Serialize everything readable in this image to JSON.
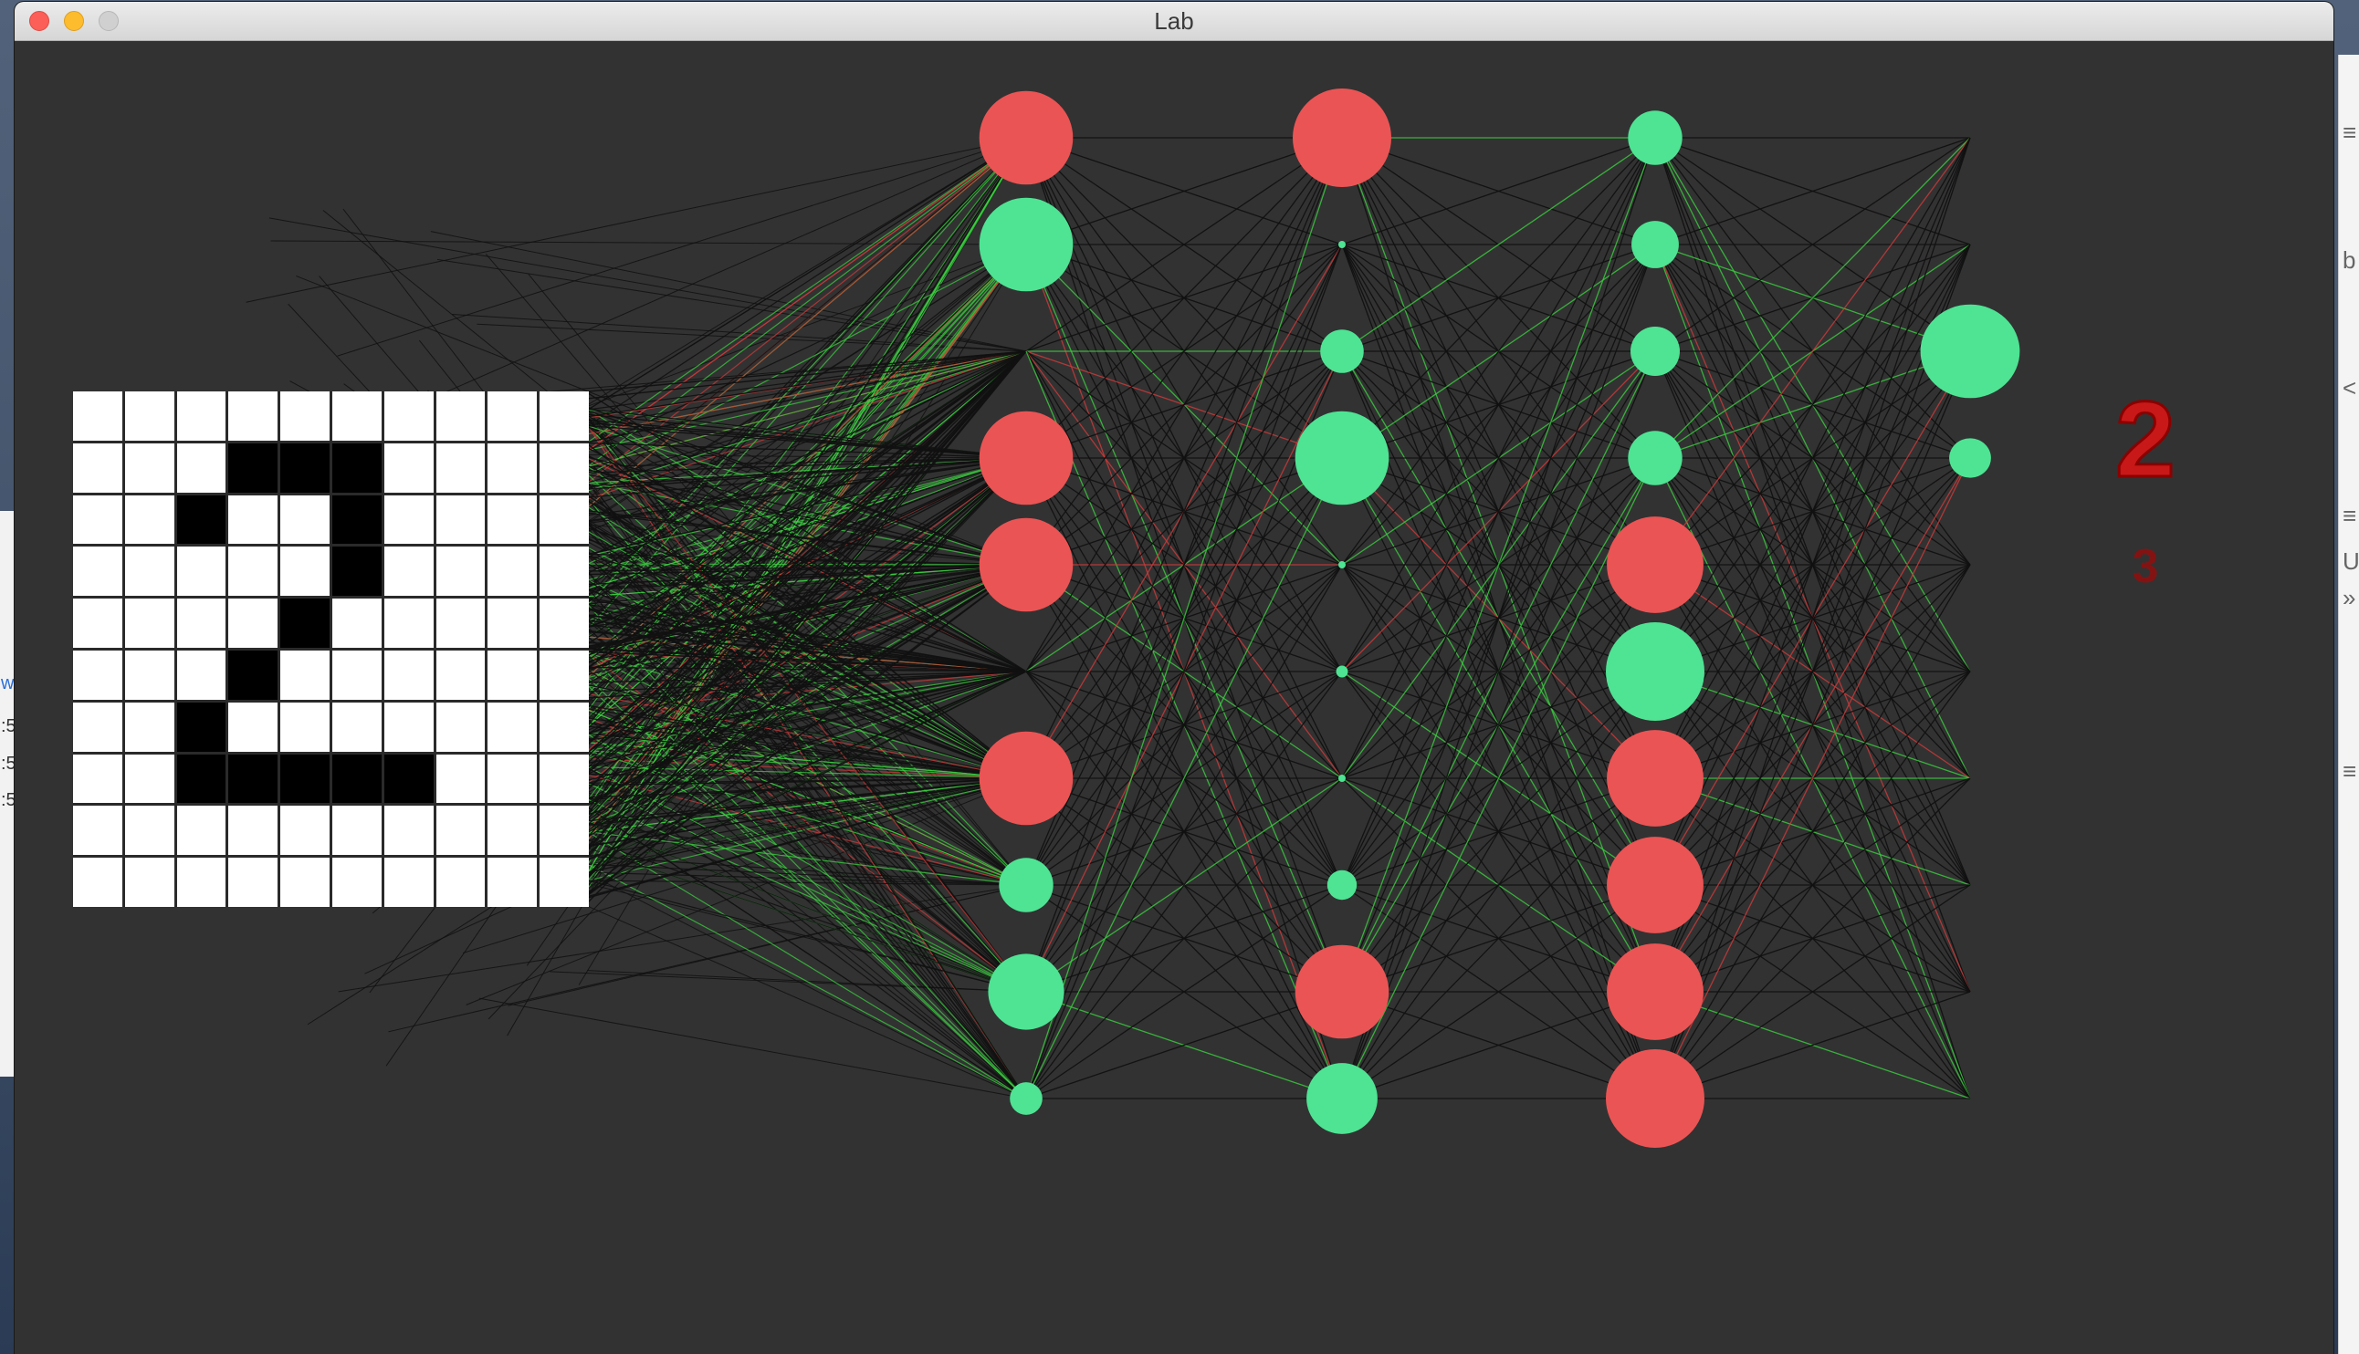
{
  "window": {
    "title": "Lab"
  },
  "background_windows": {
    "left_glyphs": [
      "w",
      ":5",
      ":5",
      ":5"
    ],
    "right_glyphs": [
      "≡",
      "b",
      "<",
      "≡",
      "U",
      "»",
      "≡"
    ]
  },
  "input_grid": {
    "rows": 10,
    "cols": 10,
    "pixels": [
      [
        0,
        0,
        0,
        0,
        0,
        0,
        0,
        0,
        0,
        0
      ],
      [
        0,
        0,
        0,
        1,
        1,
        1,
        0,
        0,
        0,
        0
      ],
      [
        0,
        0,
        1,
        0,
        0,
        1,
        0,
        0,
        0,
        0
      ],
      [
        0,
        0,
        0,
        0,
        0,
        1,
        0,
        0,
        0,
        0
      ],
      [
        0,
        0,
        0,
        0,
        1,
        0,
        0,
        0,
        0,
        0
      ],
      [
        0,
        0,
        0,
        1,
        0,
        0,
        0,
        0,
        0,
        0
      ],
      [
        0,
        0,
        1,
        0,
        0,
        0,
        0,
        0,
        0,
        0
      ],
      [
        0,
        0,
        1,
        1,
        1,
        1,
        1,
        0,
        0,
        0
      ],
      [
        0,
        0,
        0,
        0,
        0,
        0,
        0,
        0,
        0,
        0
      ],
      [
        0,
        0,
        0,
        0,
        0,
        0,
        0,
        0,
        0,
        0
      ]
    ]
  },
  "network": {
    "colors": {
      "positive": "#4ee493",
      "negative": "#eb5454",
      "edge_default": "#111111",
      "edge_positive": "#39d13f",
      "edge_negative": "#d23a3a"
    },
    "layers": [
      {
        "name": "hidden-1",
        "neurons": [
          {
            "state": "negative",
            "activation": 0.95
          },
          {
            "state": "positive",
            "activation": 0.95
          },
          {
            "state": "positive",
            "activation": 0.0
          },
          {
            "state": "negative",
            "activation": 0.95
          },
          {
            "state": "negative",
            "activation": 0.95
          },
          {
            "state": "positive",
            "activation": 0.0
          },
          {
            "state": "negative",
            "activation": 0.95
          },
          {
            "state": "positive",
            "activation": 0.55
          },
          {
            "state": "positive",
            "activation": 0.77
          },
          {
            "state": "positive",
            "activation": 0.33
          }
        ]
      },
      {
        "name": "hidden-2",
        "neurons": [
          {
            "state": "negative",
            "activation": 1.0
          },
          {
            "state": "positive",
            "activation": 0.06
          },
          {
            "state": "positive",
            "activation": 0.44
          },
          {
            "state": "positive",
            "activation": 0.95
          },
          {
            "state": "positive",
            "activation": 0.06
          },
          {
            "state": "positive",
            "activation": 0.12
          },
          {
            "state": "positive",
            "activation": 0.06
          },
          {
            "state": "positive",
            "activation": 0.3
          },
          {
            "state": "negative",
            "activation": 0.95
          },
          {
            "state": "positive",
            "activation": 0.72
          }
        ]
      },
      {
        "name": "hidden-3",
        "neurons": [
          {
            "state": "positive",
            "activation": 0.55
          },
          {
            "state": "positive",
            "activation": 0.48
          },
          {
            "state": "positive",
            "activation": 0.5
          },
          {
            "state": "positive",
            "activation": 0.55
          },
          {
            "state": "negative",
            "activation": 0.98
          },
          {
            "state": "positive",
            "activation": 1.0
          },
          {
            "state": "negative",
            "activation": 0.98
          },
          {
            "state": "negative",
            "activation": 0.98
          },
          {
            "state": "negative",
            "activation": 0.98
          },
          {
            "state": "negative",
            "activation": 1.0
          }
        ]
      },
      {
        "name": "output",
        "neurons": [
          {
            "state": "positive",
            "activation": 0.0
          },
          {
            "state": "positive",
            "activation": 0.0
          },
          {
            "state": "positive",
            "activation": 0.95
          },
          {
            "state": "positive",
            "activation": 0.4
          },
          {
            "state": "positive",
            "activation": 0.0
          },
          {
            "state": "positive",
            "activation": 0.0
          },
          {
            "state": "positive",
            "activation": 0.0
          },
          {
            "state": "positive",
            "activation": 0.0
          },
          {
            "state": "positive",
            "activation": 0.0
          },
          {
            "state": "positive",
            "activation": 0.0
          }
        ]
      }
    ]
  },
  "prediction": {
    "primary": "2",
    "secondary": "3"
  }
}
